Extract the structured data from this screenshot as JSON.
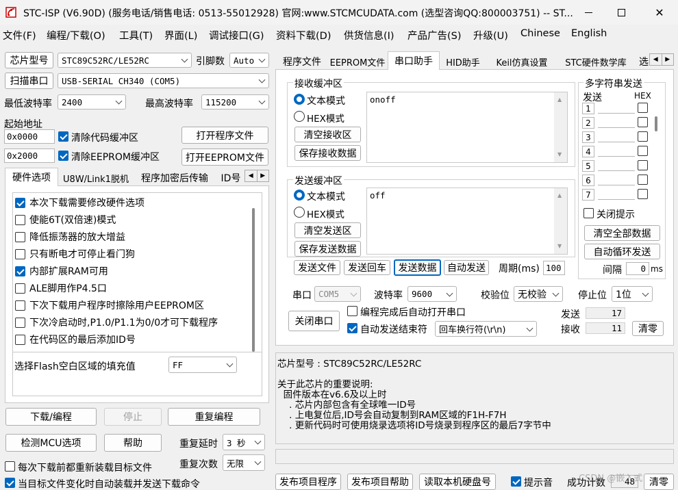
{
  "window": {
    "title": "STC-ISP (V6.90D) (服务电话/销售电话: 0513-55012928) 官网:www.STCMCUDATA.com  (选型咨询QQ:800003751) -- ST..."
  },
  "menu": [
    "文件(F)",
    "编程/下载(O)",
    "工具(T)",
    "界面(L)",
    "调试接口(G)",
    "资料下载(D)",
    "供货信息(I)",
    "产品广告(S)",
    "升级(U)",
    "Chinese",
    "English"
  ],
  "left": {
    "chip_label": "芯片型号",
    "chip_value": "STC89C52RC/LE52RC",
    "pin_label": "引脚数",
    "pin_value": "Auto",
    "scan_label": "扫描串口",
    "port_value": "USB-SERIAL CH340 (COM5)",
    "min_baud_label": "最低波特率",
    "min_baud_value": "2400",
    "max_baud_label": "最高波特率",
    "max_baud_value": "115200",
    "start_addr_label": "起始地址",
    "addr1": "0x0000",
    "addr2": "0x2000",
    "clear_code": "清除代码缓冲区",
    "clear_eeprom": "清除EEPROM缓冲区",
    "open_prog": "打开程序文件",
    "open_eeprom": "打开EEPROM文件",
    "tabs": [
      "硬件选项",
      "U8W/Link1脱机",
      "程序加密后传输",
      "ID号"
    ],
    "options": [
      {
        "label": "本次下载需要修改硬件选项",
        "checked": true
      },
      {
        "label": "使能6T(双倍速)模式",
        "checked": false
      },
      {
        "label": "降低振荡器的放大增益",
        "checked": false
      },
      {
        "label": "只有断电才可停止看门狗",
        "checked": false
      },
      {
        "label": "内部扩展RAM可用",
        "checked": true
      },
      {
        "label": "ALE脚用作P4.5口",
        "checked": false
      },
      {
        "label": "下次下载用户程序时擦除用户EEPROM区",
        "checked": false
      },
      {
        "label": "下次冷启动时,P1.0/P1.1为0/0才可下载程序",
        "checked": false
      },
      {
        "label": "在代码区的最后添加ID号",
        "checked": false
      }
    ],
    "fill_label": "选择Flash空白区域的填充值",
    "fill_value": "FF",
    "download": "下载/编程",
    "stop": "停止",
    "reprogram": "重复编程",
    "detect": "检测MCU选项",
    "help": "帮助",
    "repeat_delay_label": "重复延时",
    "repeat_delay_value": "3 秒",
    "repeat_count_label": "重复次数",
    "repeat_count_value": "无限",
    "reload_each": "每次下载前都重新装载目标文件",
    "auto_reload": "当目标文件变化时自动装载并发送下载命令"
  },
  "right": {
    "tabs": [
      "程序文件",
      "EEPROM文件",
      "串口助手",
      "HID助手",
      "Keil仿真设置",
      "STC硬件数学库",
      "选"
    ],
    "recv": {
      "title": "接收缓冲区",
      "text_mode": "文本模式",
      "hex_mode": "HEX模式",
      "clear": "清空接收区",
      "save": "保存接收数据",
      "content": "onoff"
    },
    "send": {
      "title": "发送缓冲区",
      "text_mode": "文本模式",
      "hex_mode": "HEX模式",
      "clear": "清空发送区",
      "save": "保存发送数据",
      "content": "off"
    },
    "multi": {
      "title": "多字符串发送",
      "send_col": "发送",
      "hex_col": "HEX",
      "rows": [
        "1",
        "2",
        "3",
        "4",
        "5",
        "6",
        "7"
      ],
      "close_hint": "关闭提示",
      "clear_all": "清空全部数据",
      "auto_loop": "自动循环发送",
      "interval_label": "间隔",
      "interval_value": "0",
      "interval_unit": "ms"
    },
    "send_file": "发送文件",
    "send_return": "发送回车",
    "send_data": "发送数据",
    "auto_send": "自动发送",
    "period_label": "周期(ms)",
    "period_value": "100",
    "port_label": "串口",
    "port_value": "COM5",
    "baud_label": "波特率",
    "baud_value": "9600",
    "parity_label": "校验位",
    "parity_value": "无校验",
    "stop_label": "停止位",
    "stop_value": "1位",
    "close_port": "关闭串口",
    "auto_open": "编程完成后自动打开串口",
    "auto_end": "自动发送结束符",
    "end_value": "回车换行符(\\r\\n)",
    "sent_label": "发送",
    "sent_value": "17",
    "recv_label": "接收",
    "recv_value": "11",
    "clear_count": "清零",
    "info": {
      "chip_line": "芯片型号 : STC89C52RC/LE52RC",
      "lines": [
        "关于此芯片的重要说明:",
        "  固件版本在v6.6及以上时",
        "    . 芯片内部包含有全球唯一ID号",
        "    . 上电复位后,ID号会自动复制到RAM区域的F1H-F7H",
        "    . 更新代码时可使用烧录选项将ID号烧录到程序区的最后7字节中"
      ]
    },
    "publish_prog": "发布项目程序",
    "publish_help": "发布项目帮助",
    "read_disk": "读取本机硬盘号",
    "beep": "提示音",
    "success_count_label": "成功计数",
    "success_count_value": "48",
    "clear_success": "清零"
  },
  "watermark": "CSDN @嵌入式"
}
